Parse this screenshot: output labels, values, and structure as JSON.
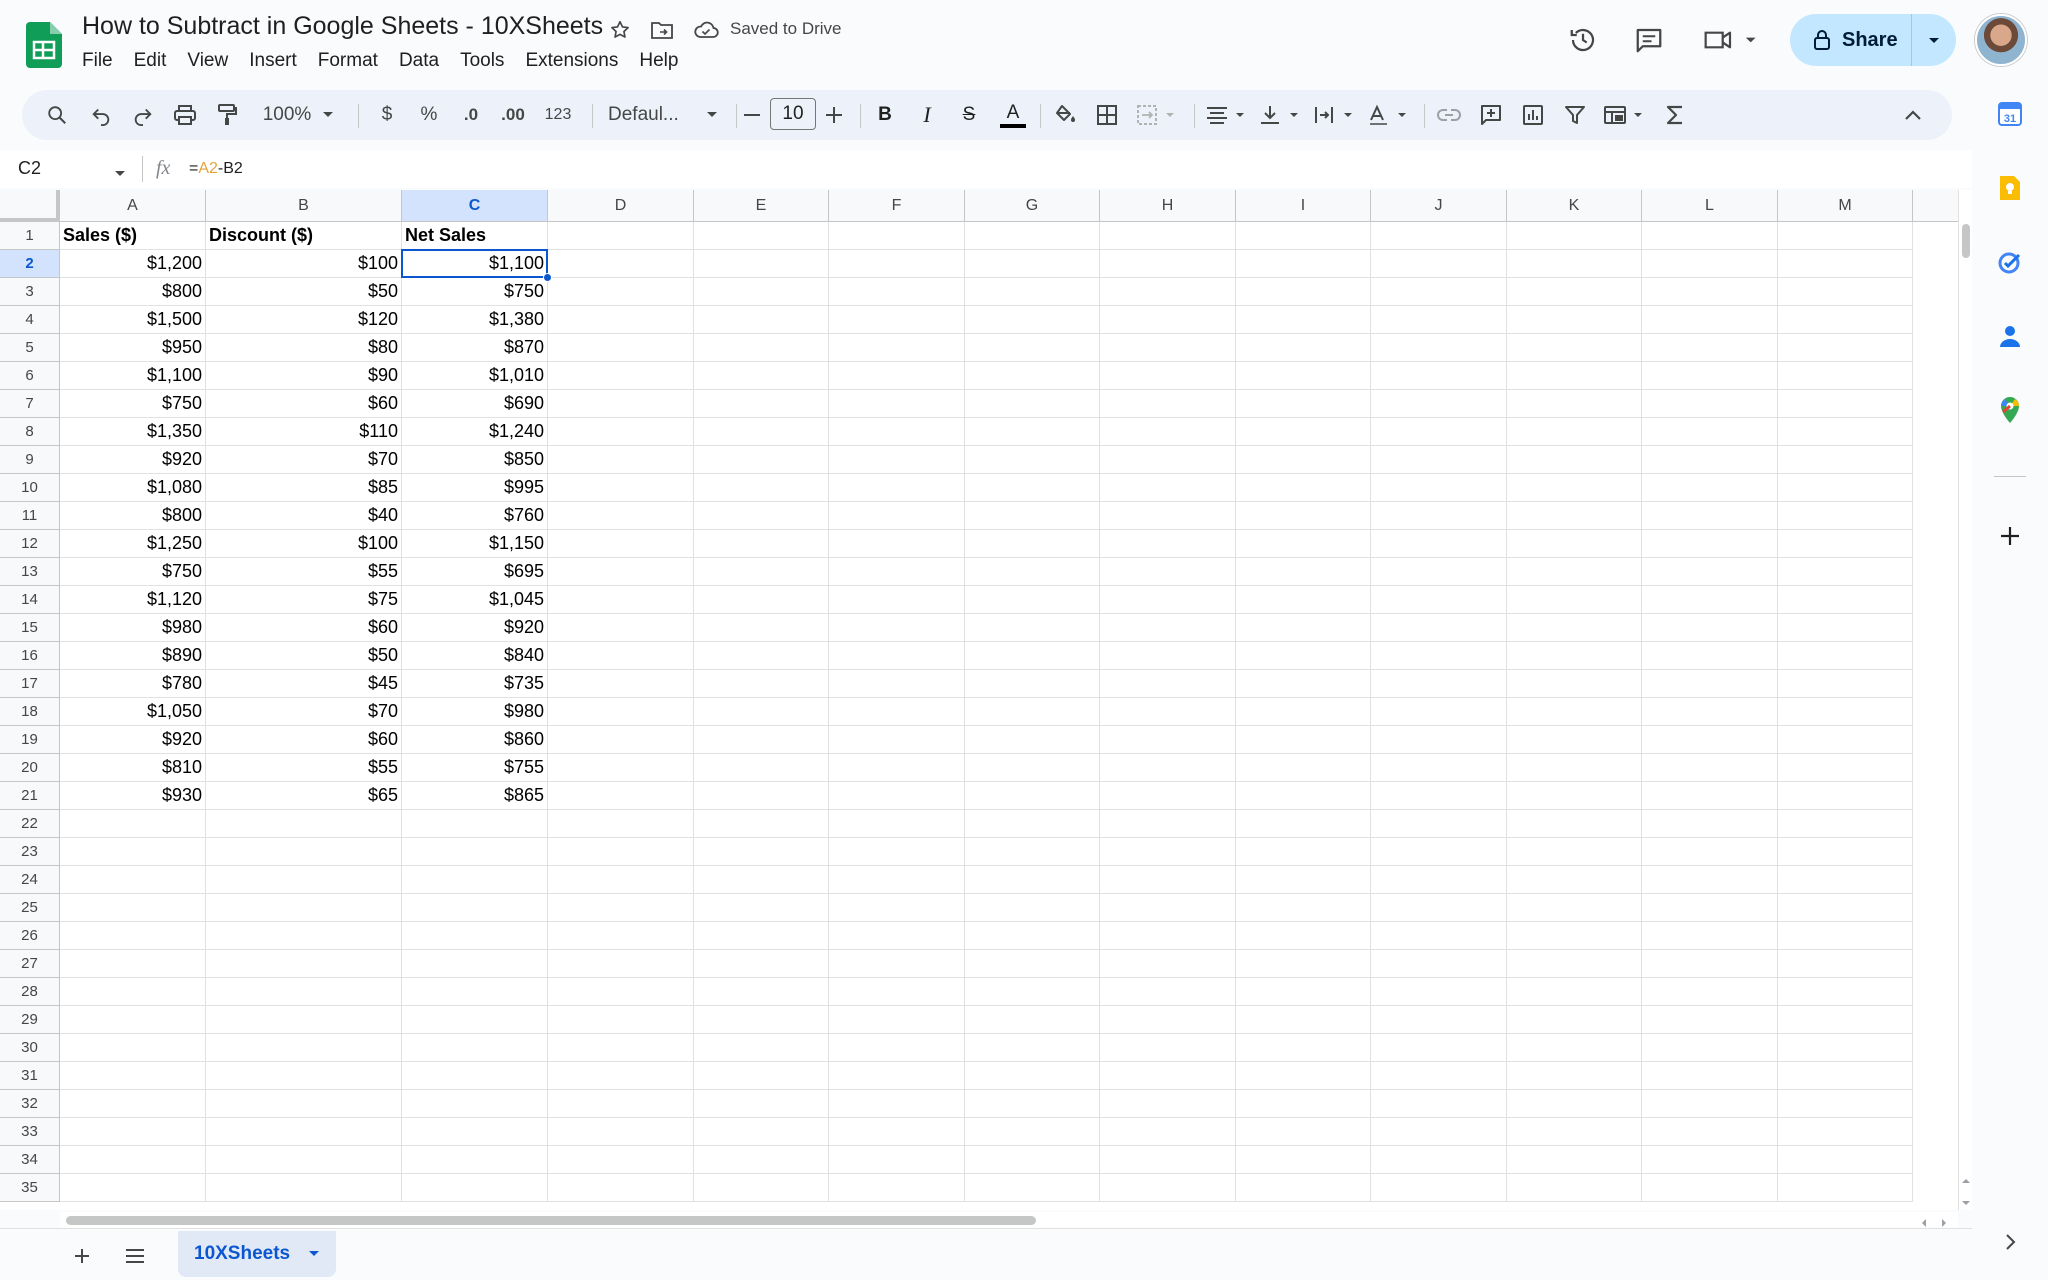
{
  "app": {
    "doc_title": "How to Subtract in Google Sheets - 10XSheets",
    "saved_status": "Saved to Drive",
    "share_label": "Share"
  },
  "menu": [
    "File",
    "Edit",
    "View",
    "Insert",
    "Format",
    "Data",
    "Tools",
    "Extensions",
    "Help"
  ],
  "toolbar": {
    "zoom": "100%",
    "currency": "$",
    "percent": "%",
    "dec_decrease": ".0",
    "dec_increase": ".00",
    "number_format": "123",
    "font": "Defaul...",
    "font_size": "10",
    "bold": "B",
    "italic": "I",
    "strike": "S",
    "text_color": "A"
  },
  "formula_bar": {
    "cell_ref": "C2",
    "fx": "fx",
    "formula_prefix": "=",
    "formula_ref1": "A2",
    "formula_rest": "-B2"
  },
  "grid": {
    "columns": [
      "A",
      "B",
      "C",
      "D",
      "E",
      "F",
      "G",
      "H",
      "I",
      "J",
      "K",
      "L",
      "M"
    ],
    "selected_column": "C",
    "selected_row": 2,
    "row_numbers": [
      1,
      2,
      3,
      4,
      5,
      6,
      7,
      8,
      9,
      10,
      11,
      12,
      13,
      14,
      15,
      16,
      17,
      18,
      19,
      20,
      21,
      22,
      23,
      24,
      25,
      26,
      27,
      28,
      29,
      30,
      31,
      32,
      33,
      34,
      35
    ],
    "headers": [
      "Sales ($)",
      "Discount ($)",
      "Net Sales"
    ],
    "rows": [
      [
        "$1,200",
        "$100",
        "$1,100"
      ],
      [
        "$800",
        "$50",
        "$750"
      ],
      [
        "$1,500",
        "$120",
        "$1,380"
      ],
      [
        "$950",
        "$80",
        "$870"
      ],
      [
        "$1,100",
        "$90",
        "$1,010"
      ],
      [
        "$750",
        "$60",
        "$690"
      ],
      [
        "$1,350",
        "$110",
        "$1,240"
      ],
      [
        "$920",
        "$70",
        "$850"
      ],
      [
        "$1,080",
        "$85",
        "$995"
      ],
      [
        "$800",
        "$40",
        "$760"
      ],
      [
        "$1,250",
        "$100",
        "$1,150"
      ],
      [
        "$750",
        "$55",
        "$695"
      ],
      [
        "$1,120",
        "$75",
        "$1,045"
      ],
      [
        "$980",
        "$60",
        "$920"
      ],
      [
        "$890",
        "$50",
        "$840"
      ],
      [
        "$780",
        "$45",
        "$735"
      ],
      [
        "$1,050",
        "$70",
        "$980"
      ],
      [
        "$920",
        "$60",
        "$860"
      ],
      [
        "$810",
        "$55",
        "$755"
      ],
      [
        "$930",
        "$65",
        "$865"
      ]
    ]
  },
  "sheet_tabs": [
    "10XSheets"
  ],
  "colors": {
    "accent": "#0b57d0",
    "share_bg": "#c2e7ff",
    "toolbar_bg": "#edf2fa",
    "sheets_green": "#0f9d58"
  }
}
